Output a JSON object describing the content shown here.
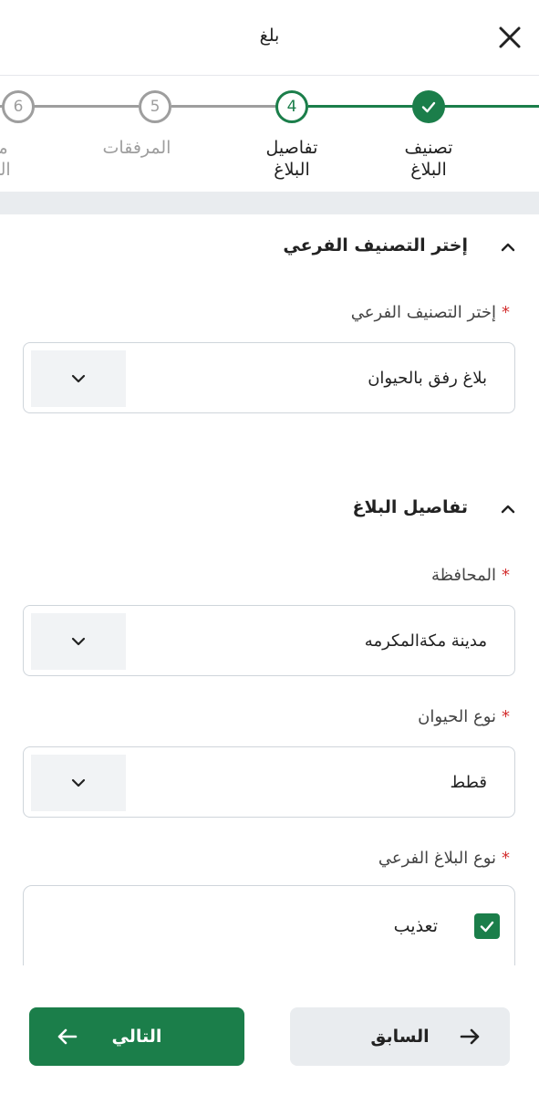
{
  "header": {
    "title": "بلغ",
    "close_icon": "close-icon"
  },
  "stepper": {
    "steps": [
      {
        "label_line1": "تصنيف",
        "label_line2": "البلاغ",
        "state": "done",
        "number": ""
      },
      {
        "label_line1": "تفاصيل",
        "label_line2": "البلاغ",
        "state": "current",
        "number": "4"
      },
      {
        "label_line1": "المرفقات",
        "label_line2": "",
        "state": "upcoming",
        "number": "5"
      },
      {
        "label_line1": "مر",
        "label_line2": "الم",
        "state": "upcoming",
        "number": "6"
      }
    ]
  },
  "section_subcategory": {
    "title": "إختر التصنيف الفرعي",
    "field_label": "إختر التصنيف الفرعي",
    "value": "بلاغ رفق بالحيوان"
  },
  "section_details": {
    "title": "تفاصيل البلاغ",
    "governorate_label": "المحافظة",
    "governorate_value": "مدينة مكةالمكرمه",
    "animal_label": "نوع الحيوان",
    "animal_value": "قطط",
    "subtype_label": "نوع البلاغ الفرعي",
    "subtype_option": "تعذيب",
    "subtype_checked": true
  },
  "required_mark": "*",
  "footer": {
    "next_label": "التالي",
    "prev_label": "السابق"
  },
  "colors": {
    "primary": "#1b7e4a",
    "required": "#d32f2f",
    "inactive": "#9e9e9e"
  }
}
